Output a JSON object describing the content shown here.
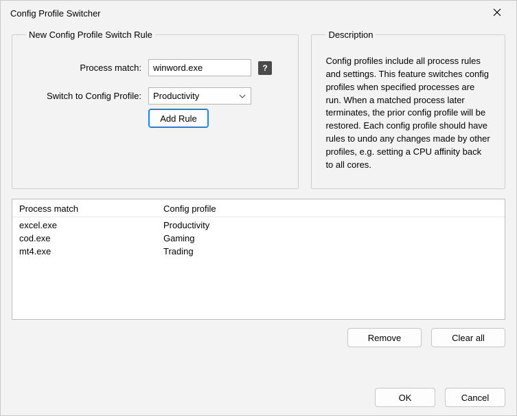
{
  "window": {
    "title": "Config Profile Switcher"
  },
  "rule_group": {
    "legend": "New Config Profile Switch Rule",
    "process_match_label": "Process match:",
    "process_match_value": "winword.exe",
    "switch_profile_label": "Switch to Config Profile:",
    "switch_profile_value": "Productivity",
    "add_rule_label": "Add Rule"
  },
  "description_group": {
    "legend": "Description",
    "text": "Config profiles include all process rules and settings. This feature switches config profiles when specified processes are run. When a matched process later terminates, the prior config profile will be restored. Each config profile should have rules to undo any changes made by other profiles, e.g. setting a CPU affinity back to all cores."
  },
  "list": {
    "columns": {
      "process_match": "Process match",
      "config_profile": "Config profile"
    },
    "rows": [
      {
        "process_match": "excel.exe",
        "config_profile": "Productivity"
      },
      {
        "process_match": "cod.exe",
        "config_profile": "Gaming"
      },
      {
        "process_match": "mt4.exe",
        "config_profile": "Trading"
      }
    ]
  },
  "buttons": {
    "remove": "Remove",
    "clear_all": "Clear all",
    "ok": "OK",
    "cancel": "Cancel"
  }
}
